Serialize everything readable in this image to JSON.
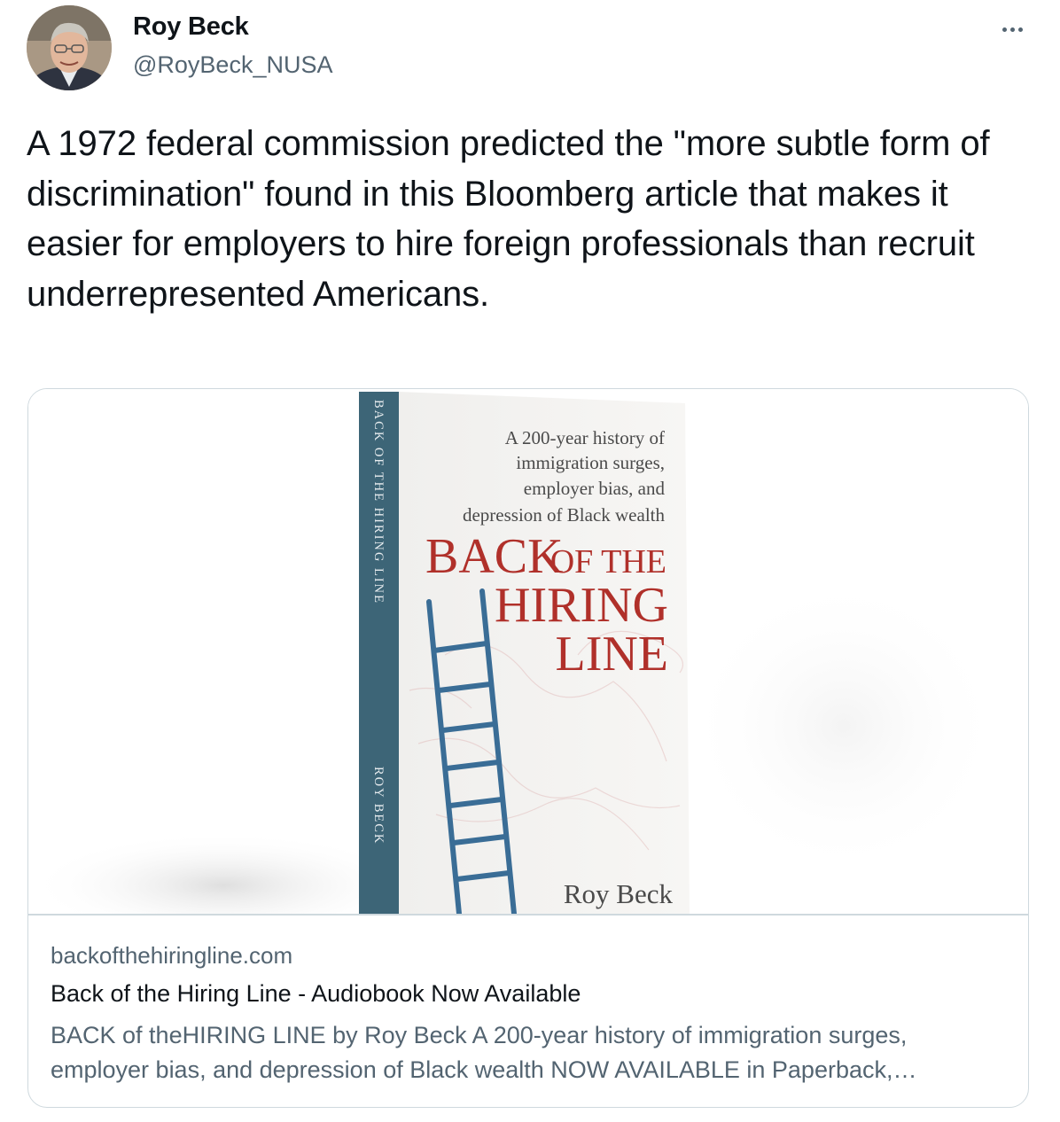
{
  "author": {
    "name": "Roy Beck",
    "handle": "@RoyBeck_NUSA"
  },
  "tweet": {
    "text": "A 1972 federal commission predicted the \"more subtle form of discrimination\" found in this Bloomberg article that makes it easier for employers to hire foreign professionals than recruit underrepresented Americans."
  },
  "card": {
    "domain": "backofthehiringline.com",
    "title": "Back of the Hiring Line - Audiobook Now Available",
    "description": "BACK of theHIRING LINE by Roy Beck A 200-year history of immigration surges, employer bias, and depression of Black wealth NOW AVAILABLE in Paperback,…",
    "book": {
      "spine_title": "BACK OF THE HIRING LINE",
      "spine_author": "ROY BECK",
      "subtitle_lines": [
        "A 200-year history of",
        "immigration surges,",
        "employer bias, and",
        "depression of Black wealth"
      ],
      "title_back": "BACK",
      "title_of_the": "OF THE",
      "title_hiring": "HIRING",
      "title_line": "LINE",
      "cover_author": "Roy Beck"
    }
  },
  "colors": {
    "text": "#0f1419",
    "secondary": "#536471",
    "border": "#cfd9de",
    "book_title_red": "#b0302a",
    "book_spine": "#3d6577",
    "ladder_blue": "#3a6d96"
  },
  "icons": {
    "more": "more-horizontal-icon"
  }
}
